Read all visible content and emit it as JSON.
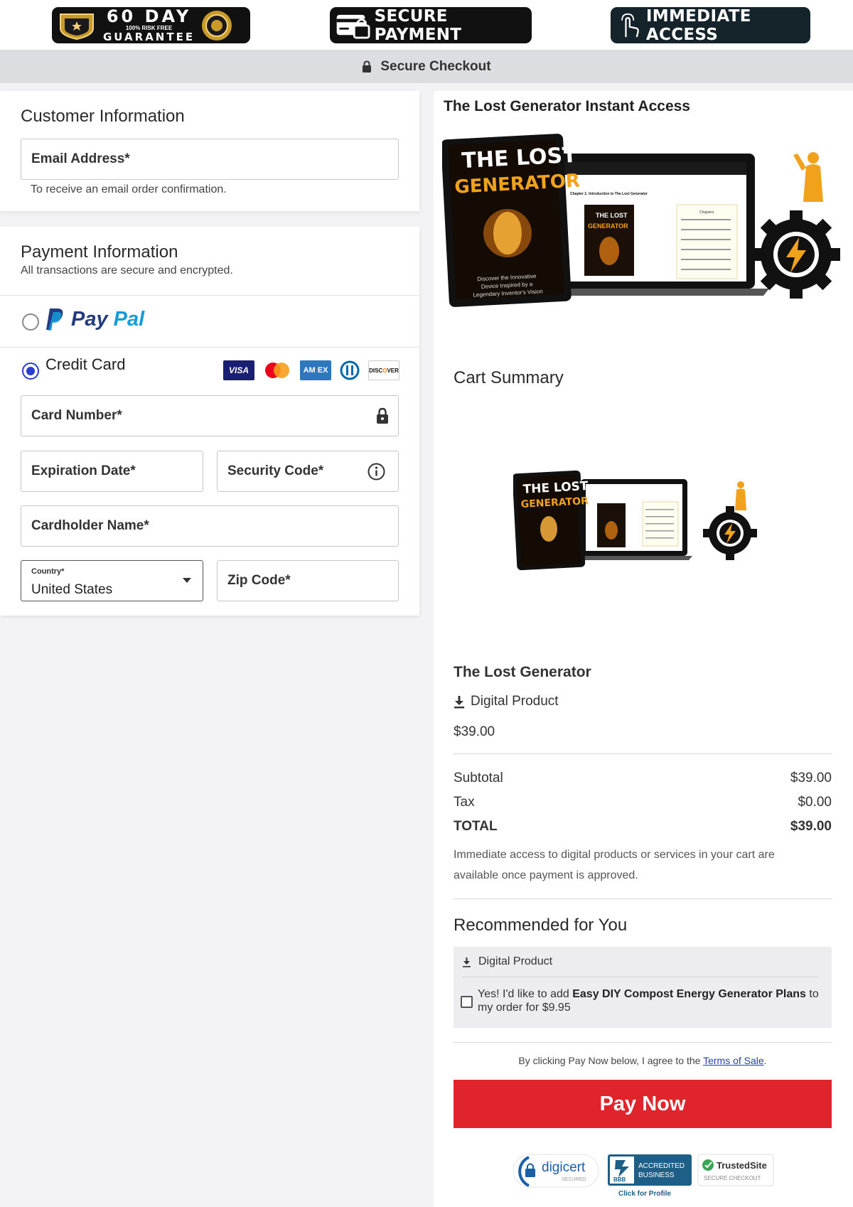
{
  "badges": {
    "guarantee_big": "60 DAY",
    "guarantee_small": "100% RISK FREE",
    "guarantee_word": "GUARANTEE",
    "secure_payment": "SECURE PAYMENT",
    "immediate_access": "IMMEDIATE ACCESS"
  },
  "secure_checkout": "Secure Checkout",
  "customer": {
    "title": "Customer Information",
    "email_placeholder": "Email Address*",
    "email_hint": "To receive an email order confirmation."
  },
  "payment": {
    "title": "Payment Information",
    "subtitle": "All transactions are secure and encrypted.",
    "paypal_word1": "Pay",
    "paypal_word2": "Pal",
    "credit_card_label": "Credit Card",
    "selected_method": "Credit Card",
    "card_brands": [
      "visa",
      "mastercard",
      "amex",
      "diners",
      "discover"
    ],
    "card_number": "Card Number*",
    "expiration": "Expiration Date*",
    "security_code": "Security Code*",
    "cardholder": "Cardholder Name*",
    "country_label": "Country*",
    "country_value": "United States",
    "zip": "Zip Code*"
  },
  "cart": {
    "header": "The Lost Generator Instant Access",
    "summary_title": "Cart Summary",
    "product_name": "The Lost Generator",
    "product_type": "Digital Product",
    "product_price": "$39.00",
    "subtotal_label": "Subtotal",
    "subtotal_value": "$39.00",
    "tax_label": "Tax",
    "tax_value": "$0.00",
    "total_label": "TOTAL",
    "total_value": "$39.00",
    "note": "Immediate access to digital products or services in your cart are available once payment is approved."
  },
  "product_image": {
    "title_line1": "THE LOST",
    "title_line2": "GENERATOR",
    "tagline_1": "Discover the Innovative",
    "tagline_2": "Device Inspired by a",
    "tagline_3": "Legendary Inventor's Vision",
    "laptop_heading": "Chapter 1: Introduction to The Lost Generator",
    "laptop_toc_title": "Chapters"
  },
  "recommended": {
    "title": "Recommended for You",
    "type": "Digital Product",
    "text_before": "Yes! I'd like to add ",
    "text_bold": "Easy DIY Compost Energy Generator Plans",
    "text_after": " to my order for $9.95"
  },
  "agree": {
    "before": "By clicking Pay Now below, I agree to the ",
    "link": "Terms of Sale",
    "after": "."
  },
  "pay_button": "Pay Now",
  "trust": {
    "digicert": "digicert",
    "digicert_sub": "SECURED",
    "bbb_1": "ACCREDITED",
    "bbb_2": "BUSINESS",
    "bbb_logo": "BBB",
    "bbb_click": "Click for Profile",
    "trusted": "TrustedSite",
    "trusted_sub": "SECURE CHECKOUT"
  },
  "colors": {
    "pay_button": "#e0242c",
    "radio_selected": "#2b3cd0",
    "paypal_dark": "#253b80",
    "paypal_light": "#179bd7",
    "accent_orange": "#f0a21c"
  }
}
